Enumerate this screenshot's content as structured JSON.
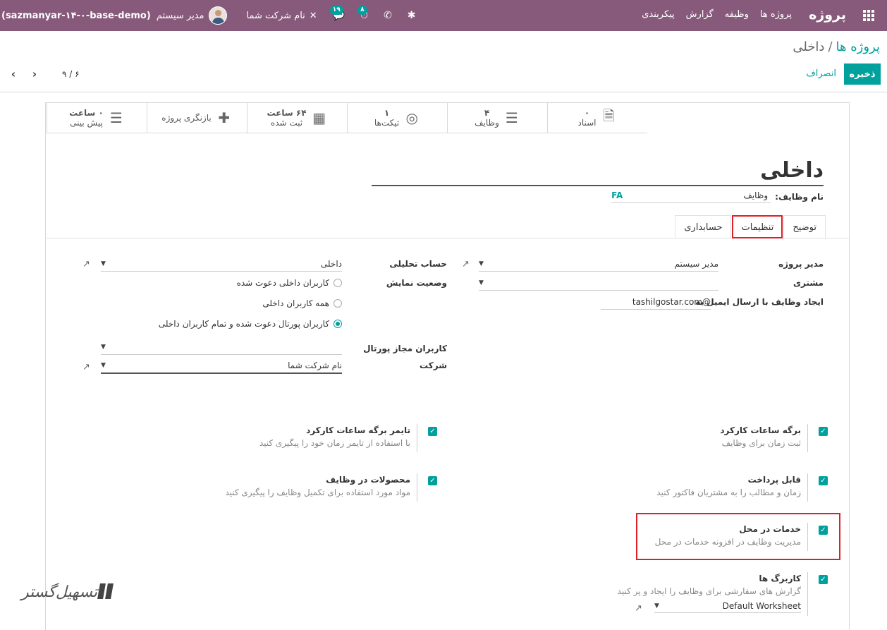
{
  "navbar": {
    "brand": "پروژه",
    "menu": [
      "پروژه ها",
      "وظیفه",
      "گزارش",
      "پیکربندی"
    ],
    "user_name": "مدیر سیستم",
    "database": "(sazmanyar-۱۴-۰-base-demo)",
    "company": "نام شرکت شما",
    "activity_badge": "۸",
    "messages_badge": "۱۹"
  },
  "breadcrumb": {
    "parent": "پروژه ها",
    "separator": "/",
    "current": "داخلی"
  },
  "actions": {
    "save": "ذخیره",
    "discard": "انصراف"
  },
  "pager": {
    "value": "۹ / ۶",
    "prev": "‹",
    "next": "›"
  },
  "stats": [
    {
      "value": "۰",
      "label": "اسناد",
      "icon": "document-icon"
    },
    {
      "value": "۴",
      "label": "وظایف",
      "icon": "tasks-icon"
    },
    {
      "value": "۱",
      "label": "تیکت‌ها",
      "icon": "support-icon"
    },
    {
      "value": "۶۴ ساعت",
      "label": "ثبت شده",
      "icon": "calendar-icon"
    },
    {
      "value": "",
      "label": "بازنگری پروژه",
      "icon": "puzzle-icon"
    },
    {
      "value": "۰ ساعت",
      "label": "پیش بینی",
      "icon": "forecast-icon"
    }
  ],
  "project": {
    "name": "داخلی",
    "tasks_label": "نام وظایف:",
    "tasks_value": "وظایف",
    "tasks_lang": "FA"
  },
  "tabs": [
    "توضیح",
    "تنظیمات",
    "حسابداری"
  ],
  "fields": {
    "manager_label": "مدیر پروژه",
    "manager_value": "مدیر سیستم",
    "customer_label": "مشتری",
    "customer_value": "",
    "email_label": "ایجاد وظایف با ارسال ایمیل به",
    "email_value": "tashilgostar.com@",
    "analytic_label": "حساب تحلیلی",
    "analytic_value": "داخلی",
    "visibility_label": "وضعیت نمایش",
    "visibility_options": [
      "کاربران داخلی دعوت شده",
      "همه کاربران داخلی",
      "کاربران پورتال دعوت شده و تمام کاربران داخلی"
    ],
    "visibility_selected_index": 2,
    "portal_users_label": "کاربران مجاز پورتال",
    "portal_users_value": "",
    "company_label": "شرکت",
    "company_value": "نام شرکت شما"
  },
  "settings": [
    {
      "title": "برگه ساعات کارکرد",
      "desc": "ثبت زمان برای وظایف",
      "checked": true
    },
    {
      "title": "تایمر برگه ساعات کارکرد",
      "desc": "با استفاده از تایمر زمان خود را پیگیری کنید",
      "checked": true
    },
    {
      "title": "قابل پرداخت",
      "desc": "زمان و مطالب را به مشتریان فاکتور کنید",
      "checked": true
    },
    {
      "title": "محصولات در وظایف",
      "desc": "مواد مورد استفاده برای تکمیل وظایف را پیگیری کنید",
      "checked": true
    },
    {
      "title": "خدمات در محل",
      "desc": "مدیریت وظایف در افزونه خدمات در محل",
      "checked": true
    },
    {
      "title": "کاربرگ ها",
      "desc": "گزارش های سفارشی برای وظایف را ایجاد و پر کنید",
      "checked": true
    }
  ],
  "worksheet_template": "Default Worksheet",
  "watermark": "تسهیل‌گستر",
  "colors": {
    "navbar": "#875a7b",
    "accent": "#00a09d",
    "highlight": "#e01e26"
  }
}
